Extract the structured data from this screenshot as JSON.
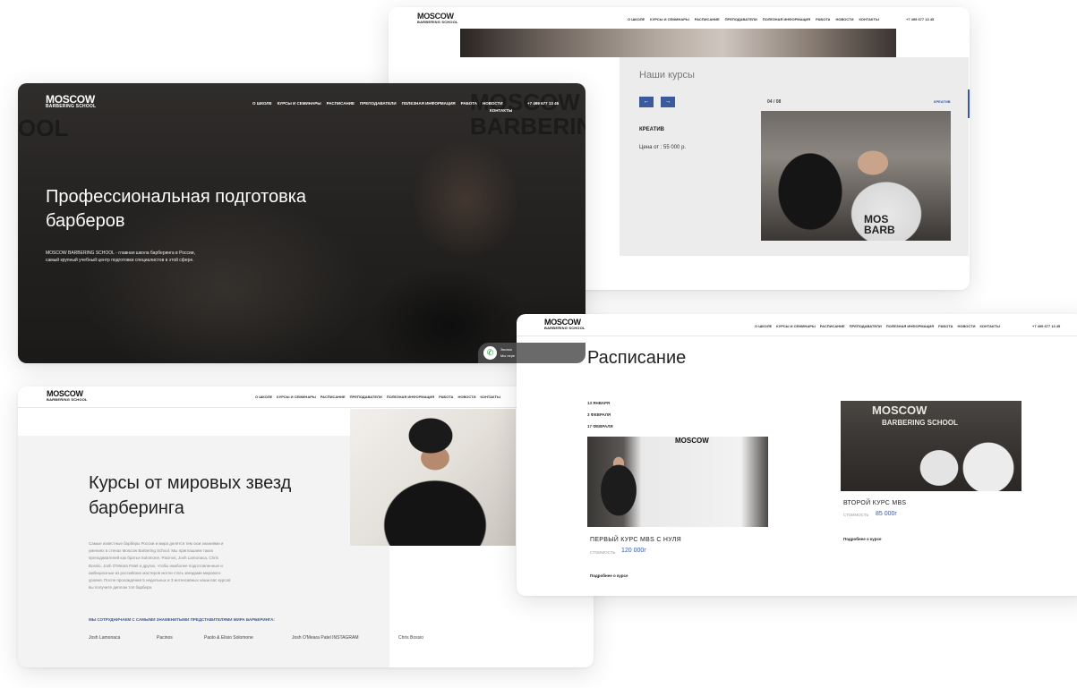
{
  "brand": {
    "line1": "MOSCOW",
    "line2": "BARBERING SCHOOL"
  },
  "nav": [
    "О ШКОЛЕ",
    "КУРСЫ И СЕМИНАРЫ",
    "РАСПИСАНИЕ",
    "ПРЕПОДАВАТЕЛИ",
    "ПОЛЕЗНАЯ ИНФОРМАЦИЯ",
    "РАБОТА",
    "НОВОСТИ",
    "КОНТАКТЫ"
  ],
  "phone": "+7 499 677 13 45",
  "hero": {
    "wall_text": "MOSCOW\nBARBERING SC",
    "wall_text2": "OOL",
    "title": "Профессиональная подготовка барберов",
    "description": "MOSCOW BARBERING SCHOOL - главная школа барберинга в России, самый крупный учебный центр подготовки специалистов в этой сфере.",
    "widget_text": "Звонок\nМы пере"
  },
  "courses": {
    "title": "Наши курсы",
    "prev": "←",
    "next": "→",
    "counter": "04 / 08",
    "link": "КРЕАТИВ",
    "course_name": "КРЕАТИВ",
    "price": "Цена от : 55 000 р.",
    "image_text": "MOS\nBARB"
  },
  "stars": {
    "title": "Курсы от мировых звезд барберинга",
    "description": "Самые известные барберы России и мира делятся тем сюи знаниями и умениях в стенах Moscow Barbering School. Мы приглашаем таких преподавателей как братья Solomone, Pacinos, Josh Lamonaca, Chris Bossio, Josh O'Meara Patel и других, чтобы наиболее подготовленные и амбициозные из российских мастеров могли стать звездами мирового уровня. После прохождения 5 недельных и 3 интенсивных наши вас курсов вы получите диплом топ барбера.",
    "collab": "МЫ СОТРУДНИЧАЕМ С САМЫМИ ЗНАМЕНИТЫМИ ПРЕДСТАВИТЕЛЯМИ МИРА БАРБЕРИНГА:",
    "names": [
      "Josh Lamonaca",
      "Pacinos",
      "Paolo & Elisio Solomone",
      "Josh O'Meara Patel INSTAGRAM",
      "Chris Bossio"
    ]
  },
  "schedule": {
    "title": "Расписание",
    "dates": [
      "13 ЯНВАРЯ",
      "3 ФЕВРАЛЯ",
      "17 ФЕВРАЛЯ"
    ],
    "course1": {
      "name": "ПЕРВЫЙ КУРС MBS С НУЛЯ",
      "cost_label": "СТОИМОСТЬ",
      "cost": "120 000г",
      "more": "Подробнее о курсе",
      "board_text": "MOSCOW"
    },
    "course2": {
      "name": "ВТОРОЙ КУРС MBS",
      "cost_label": "СТОИМОСТЬ",
      "cost": "85 000г",
      "more": "Подробнее о курсе",
      "img_text1": "MOSCOW",
      "img_text2": "BARBERING SCHOOL"
    }
  },
  "colors": {
    "accent": "#3a5a9c",
    "panel_gray": "#ececec",
    "text_dark": "#222222"
  }
}
